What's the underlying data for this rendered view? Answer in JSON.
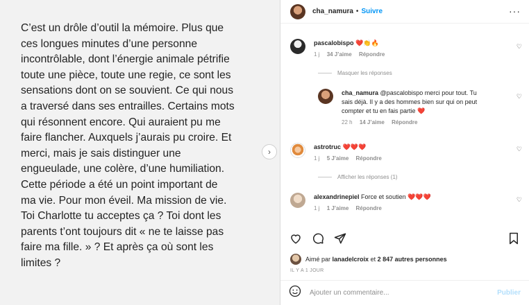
{
  "post_text_lines": [
    "C’est un drôle d’outil la mémoire. Plus que",
    "ces longues minutes d’une personne",
    "incontrôlable, dont l’énergie animale pétrifie",
    "toute une pièce, toute une regie,  ce sont les",
    "sensations dont on se souvient. Ce qui nous",
    "a traversé dans ses entrailles. Certains mots",
    "qui résonnent encore. Qui auraient pu me",
    "faire flancher. Auxquels j’aurais pu croire. Et",
    "merci, mais je sais distinguer une",
    "engueulade, une colère, d’une humiliation.",
    "Cette période a été un point important de",
    "ma vie. Pour mon éveil. Ma mission de vie.",
    "Toi Charlotte tu acceptes ça ? Toi dont les",
    "parents t’ont toujours dit « ne te laisse pas",
    "faire ma fille. » ? Et après ça où sont les",
    "limites ?"
  ],
  "header": {
    "username": "cha_namura",
    "separator": "•",
    "follow": "Suivre",
    "more": "···"
  },
  "comments": {
    "c1": {
      "user": "pascalobispo",
      "text": "❤️👏🔥",
      "time": "1 j",
      "likes": "34 J’aime",
      "reply": "Répondre"
    },
    "hide_replies": "Masquer les réponses",
    "c1_reply": {
      "user": "cha_namura",
      "text_lines": [
        "@pascalobispo merci pour tout. Tu",
        "sais déjà. Il y a des hommes bien sur qui on peut",
        "compter et tu en fais partie ❤️"
      ],
      "time": "22 h",
      "likes": "14 J’aime",
      "reply": "Répondre"
    },
    "c2": {
      "user": "astrotruc",
      "text": "❤️❤️❤️",
      "time": "1 j",
      "likes": "5 J’aime",
      "reply": "Répondre"
    },
    "show_replies": "Afficher les réponses (1)",
    "c3": {
      "user": "alexandrinepiel",
      "text": "Force et soutien ❤️❤️❤️",
      "time": "1 j",
      "likes": "1 J’aime",
      "reply": "Répondre"
    }
  },
  "likes": {
    "prefix": "Aimé par",
    "user": "lanadelcroix",
    "middle": "et",
    "others": "2 847 autres personnes"
  },
  "post_date": "IL Y A 1 JOUR",
  "add_comment": {
    "placeholder": "Ajouter un commentaire...",
    "publish": "Publier"
  },
  "icons": [
    "heart-icon",
    "comment-icon",
    "share-icon",
    "bookmark-icon",
    "emoji-icon",
    "chevron-right-icon"
  ]
}
